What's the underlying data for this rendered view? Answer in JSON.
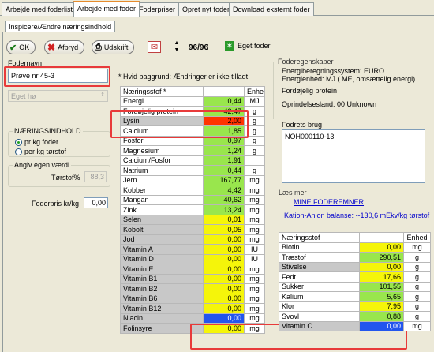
{
  "tabs": [
    "Arbejde med foderliste",
    "Arbejde med foder",
    "Foderpriser",
    "Opret nyt foder",
    "Download eksternt foder"
  ],
  "subtab": "Inspicere/Ændre næringsindhold",
  "toolbar": {
    "ok": "OK",
    "cancel": "Afbryd",
    "print": "Udskrift",
    "counter": "96/96",
    "own_feed": "Eget foder"
  },
  "fodernavn_label": "Fodernavn",
  "fodernavn_value": "Prøve nr 45-3",
  "feed_type": "Eget hø",
  "hint": "* Hvid baggrund: Ændringer er ikke tilladt",
  "naering": {
    "title": "NÆRINGSINDHOLD",
    "opt1": "pr kg foder",
    "opt2": "per kg tørstof"
  },
  "egen": {
    "title": "Angiv egen værdi",
    "label": "Tørstof%",
    "value": "88,3"
  },
  "price": {
    "label": "Foderpris kr/kg",
    "value": "0,00"
  },
  "nut_header": {
    "name": "Næringsstof *",
    "unit": "Enhed"
  },
  "nutrients": [
    {
      "name": "Energi",
      "value": "0,44",
      "unit": "MJ",
      "gray": false,
      "bg": "#99e64d"
    },
    {
      "name": "Fordøjelig protein",
      "value": "42,47",
      "unit": "g",
      "gray": false,
      "bg": "#99e64d"
    },
    {
      "name": "Lysin",
      "value": "2,00",
      "unit": "g",
      "gray": true,
      "bg": "#ff3300"
    },
    {
      "name": "Calcium",
      "value": "1,85",
      "unit": "g",
      "gray": false,
      "bg": "#99e64d"
    },
    {
      "name": "Fosfor",
      "value": "0,97",
      "unit": "g",
      "gray": false,
      "bg": "#99e64d"
    },
    {
      "name": "Magnesium",
      "value": "1,24",
      "unit": "g",
      "gray": false,
      "bg": "#99e64d"
    },
    {
      "name": "Calcium/Fosfor",
      "value": "1,91",
      "unit": "",
      "gray": false,
      "bg": "#99e64d"
    },
    {
      "name": "Natrium",
      "value": "0,44",
      "unit": "g",
      "gray": false,
      "bg": "#99e64d"
    },
    {
      "name": "Jern",
      "value": "167,77",
      "unit": "mg",
      "gray": false,
      "bg": "#99e64d"
    },
    {
      "name": "Kobber",
      "value": "4,42",
      "unit": "mg",
      "gray": false,
      "bg": "#99e64d"
    },
    {
      "name": "Mangan",
      "value": "40,62",
      "unit": "mg",
      "gray": false,
      "bg": "#99e64d"
    },
    {
      "name": "Zink",
      "value": "13,24",
      "unit": "mg",
      "gray": false,
      "bg": "#99e64d"
    },
    {
      "name": "Selen",
      "value": "0,01",
      "unit": "mg",
      "gray": true,
      "bg": "#f5f50a"
    },
    {
      "name": "Kobolt",
      "value": "0,05",
      "unit": "mg",
      "gray": true,
      "bg": "#f5f50a"
    },
    {
      "name": "Jod",
      "value": "0,00",
      "unit": "mg",
      "gray": true,
      "bg": "#f5f50a"
    },
    {
      "name": "Vitamin A",
      "value": "0,00",
      "unit": "IU",
      "gray": true,
      "bg": "#f5f50a"
    },
    {
      "name": "Vitamin D",
      "value": "0,00",
      "unit": "IU",
      "gray": true,
      "bg": "#f5f50a"
    },
    {
      "name": "Vitamin E",
      "value": "0,00",
      "unit": "mg",
      "gray": true,
      "bg": "#f5f50a"
    },
    {
      "name": "Vitamin B1",
      "value": "0,00",
      "unit": "mg",
      "gray": true,
      "bg": "#f5f50a"
    },
    {
      "name": "Vitamin B2",
      "value": "0,00",
      "unit": "mg",
      "gray": true,
      "bg": "#f5f50a"
    },
    {
      "name": "Vitamin B6",
      "value": "0,00",
      "unit": "mg",
      "gray": true,
      "bg": "#f5f50a"
    },
    {
      "name": "Vitamin B12",
      "value": "0,00",
      "unit": "mg",
      "gray": true,
      "bg": "#f5f50a"
    },
    {
      "name": "Niacin",
      "value": "0,00",
      "unit": "mg",
      "gray": true,
      "bg": "#2255ee"
    },
    {
      "name": "Folinsyre",
      "value": "0,00",
      "unit": "mg",
      "gray": true,
      "bg": "#f5f50a"
    }
  ],
  "props": {
    "title": "Foderegenskaber",
    "line1": "Energiberegningssystem: EURO",
    "line2": "Energienhed:   MJ ( ME, omsættelig energi)",
    "line3": "Fordøjelig protein",
    "line4": "Oprindelsesland: 00 Unknown"
  },
  "brug": {
    "title": "Fodrets brug",
    "value": "NOH000110-13"
  },
  "more": {
    "title": "Læs mer",
    "link": "MINE FODEREMNER",
    "kation": "Kation-Anion balanse: --130,6 mEkv/kg tørstof"
  },
  "right_header": {
    "name": "Næringsstof",
    "unit": "Enhed"
  },
  "right_nutrients": [
    {
      "name": "Biotin",
      "value": "0,00",
      "unit": "mg",
      "bg": "#f5f50a"
    },
    {
      "name": "Træstof",
      "value": "290,51",
      "unit": "g",
      "bg": "#99e64d"
    },
    {
      "name": "Stivelse",
      "value": "0,00",
      "unit": "g",
      "bg": "#f5f50a"
    },
    {
      "name": "Fedt",
      "value": "17,66",
      "unit": "g",
      "bg": "#f5f50a"
    },
    {
      "name": "Sukker",
      "value": "101,55",
      "unit": "g",
      "bg": "#99e64d"
    },
    {
      "name": "Kalium",
      "value": "5,65",
      "unit": "g",
      "bg": "#99e64d"
    },
    {
      "name": "Klor",
      "value": "7,95",
      "unit": "g",
      "bg": "#f5f50a"
    },
    {
      "name": "Svovl",
      "value": "0,88",
      "unit": "g",
      "bg": "#99e64d"
    },
    {
      "name": "Vitamin C",
      "value": "0,00",
      "unit": "mg",
      "bg": "#2255ee"
    }
  ]
}
